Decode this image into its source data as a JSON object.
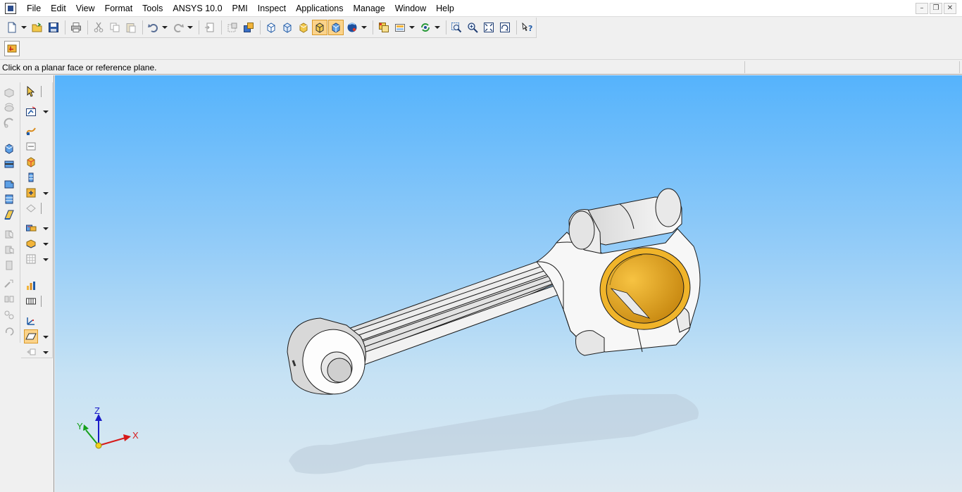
{
  "menubar": {
    "items": [
      "File",
      "Edit",
      "View",
      "Format",
      "Tools",
      "ANSYS 10.0",
      "PMI",
      "Inspect",
      "Applications",
      "Manage",
      "Window",
      "Help"
    ],
    "window_controls": [
      "–",
      "❐",
      "✕"
    ]
  },
  "toolbar": {
    "icons": [
      "new-icon",
      "open-icon",
      "save-icon",
      "print-icon",
      "cut-icon",
      "copy-icon",
      "paste-icon",
      "undo-icon",
      "redo-icon",
      "import-icon",
      "wireframe-icon",
      "shaded-icon",
      "sphere-icon",
      "component-icon",
      "layers-icon",
      "refresh-icon",
      "zoom-area-icon",
      "zoom-icon",
      "fit-icon",
      "rotate-icon",
      "help-icon"
    ],
    "active": [
      "shaded-edges-icon",
      "shaded-icon"
    ]
  },
  "status": {
    "prompt": "Click on a planar face or reference plane."
  },
  "triad": {
    "x_label": "X",
    "y_label": "Y",
    "z_label": "Z"
  },
  "colors": {
    "viewport_top": "#55b3fc",
    "viewport_bottom": "#dde9f1",
    "bearing": "#f0b42a",
    "active_button": "#fbd38a"
  }
}
